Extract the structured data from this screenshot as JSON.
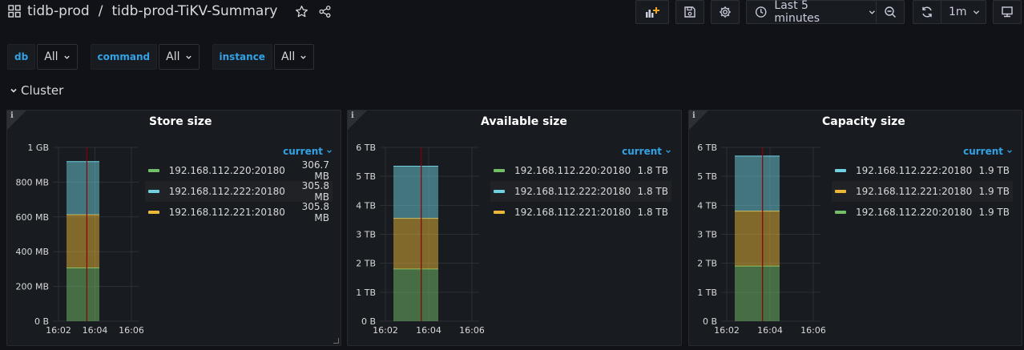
{
  "header": {
    "folder": "tidb-prod",
    "separator": "/",
    "dashboard": "tidb-prod-TiKV-Summary",
    "time_range": "Last 5 minutes",
    "refresh": "1m"
  },
  "variables": [
    {
      "label": "db",
      "value": "All"
    },
    {
      "label": "command",
      "value": "All"
    },
    {
      "label": "instance",
      "value": "All"
    }
  ],
  "row": {
    "title": "Cluster"
  },
  "colors": {
    "green": "#73bf69",
    "cyan": "#6ed0e0",
    "yellow": "#eab839",
    "accent": "#33a2e5",
    "crosshair": "#8b0000"
  },
  "panels": [
    {
      "title": "Store size",
      "legend_header": "current",
      "legend": [
        {
          "name": "192.168.112.220:20180",
          "value": "306.7 MB",
          "color": "#73bf69"
        },
        {
          "name": "192.168.112.222:20180",
          "value": "305.8 MB",
          "color": "#6ed0e0"
        },
        {
          "name": "192.168.112.221:20180",
          "value": "305.8 MB",
          "color": "#eab839"
        }
      ]
    },
    {
      "title": "Available size",
      "legend_header": "current",
      "legend": [
        {
          "name": "192.168.112.220:20180",
          "value": "1.8 TB",
          "color": "#73bf69"
        },
        {
          "name": "192.168.112.222:20180",
          "value": "1.8 TB",
          "color": "#6ed0e0"
        },
        {
          "name": "192.168.112.221:20180",
          "value": "1.8 TB",
          "color": "#eab839"
        }
      ]
    },
    {
      "title": "Capacity size",
      "legend_header": "current",
      "legend": [
        {
          "name": "192.168.112.222:20180",
          "value": "1.9 TB",
          "color": "#6ed0e0"
        },
        {
          "name": "192.168.112.221:20180",
          "value": "1.9 TB",
          "color": "#eab839"
        },
        {
          "name": "192.168.112.220:20180",
          "value": "1.9 TB",
          "color": "#73bf69"
        }
      ]
    }
  ],
  "chart_data": [
    {
      "type": "area",
      "title": "Store size",
      "x_ticks": [
        "16:02",
        "16:04",
        "16:06"
      ],
      "y_ticks": [
        "0 B",
        "200 MB",
        "400 MB",
        "600 MB",
        "800 MB",
        "1 GB"
      ],
      "ylim": [
        0,
        1000
      ],
      "y_unit": "MB",
      "stacked": true,
      "series": [
        {
          "name": "192.168.112.220:20180",
          "values": [
            306.7
          ],
          "color": "#73bf69"
        },
        {
          "name": "192.168.112.221:20180",
          "values": [
            305.8
          ],
          "color": "#eab839"
        },
        {
          "name": "192.168.112.222:20180",
          "values": [
            305.8
          ],
          "color": "#6ed0e0"
        }
      ]
    },
    {
      "type": "area",
      "title": "Available size",
      "x_ticks": [
        "16:02",
        "16:04",
        "16:06"
      ],
      "y_ticks": [
        "0 B",
        "1 TB",
        "2 TB",
        "3 TB",
        "4 TB",
        "5 TB",
        "6 TB"
      ],
      "ylim": [
        0,
        6
      ],
      "y_unit": "TB",
      "stacked": true,
      "series": [
        {
          "name": "192.168.112.220:20180",
          "values": [
            1.8
          ],
          "color": "#73bf69"
        },
        {
          "name": "192.168.112.221:20180",
          "values": [
            1.75
          ],
          "color": "#eab839"
        },
        {
          "name": "192.168.112.222:20180",
          "values": [
            1.8
          ],
          "color": "#6ed0e0"
        }
      ]
    },
    {
      "type": "area",
      "title": "Capacity size",
      "x_ticks": [
        "16:02",
        "16:04",
        "16:06"
      ],
      "y_ticks": [
        "0 B",
        "1 TB",
        "2 TB",
        "3 TB",
        "4 TB",
        "5 TB",
        "6 TB"
      ],
      "ylim": [
        0,
        6
      ],
      "y_unit": "TB",
      "stacked": true,
      "series": [
        {
          "name": "192.168.112.220:20180",
          "values": [
            1.9
          ],
          "color": "#73bf69"
        },
        {
          "name": "192.168.112.221:20180",
          "values": [
            1.9
          ],
          "color": "#eab839"
        },
        {
          "name": "192.168.112.222:20180",
          "values": [
            1.9
          ],
          "color": "#6ed0e0"
        }
      ]
    }
  ]
}
